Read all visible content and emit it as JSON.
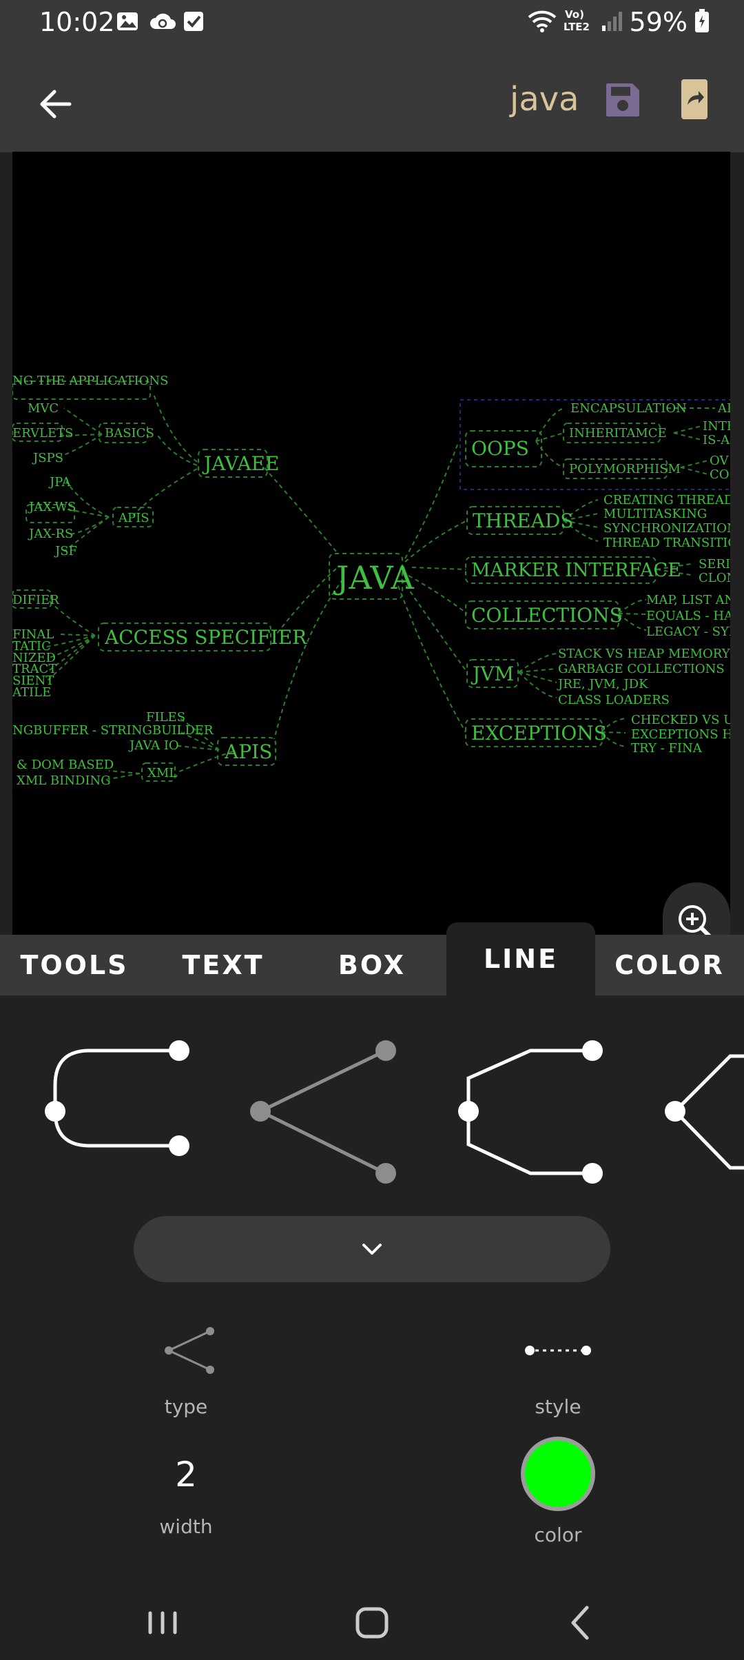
{
  "status": {
    "time": "10:02",
    "battery": "59%",
    "network": "Vo) LTE2"
  },
  "app_bar": {
    "title": "java",
    "back_icon": "arrow-left-icon",
    "save_icon": "floppy-disk-icon",
    "export_icon": "share-document-icon"
  },
  "mindmap": {
    "root": "JAVA",
    "branches": [
      "JAVAEE",
      "ACCESS SPECIFIER",
      "APIS",
      "OOPS",
      "THREADS",
      "MARKER INTERFACE",
      "COLLECTIONS",
      "JVM",
      "EXCEPTIONS"
    ],
    "javaee_children": [
      "NG THE APPLICATIONS",
      "MVC",
      "ERVLETS",
      "BASICS",
      "JSPS",
      "JPA",
      "JAX-WS",
      "APIS",
      "JAX-RS",
      "JSF"
    ],
    "access_children": [
      "DIFIER",
      "FINAL",
      "TATIC",
      "NIZED",
      "TRACT",
      "SIENT",
      "ATILE"
    ],
    "apis_children": [
      "FILES",
      "NGBUFFER - STRINGBUILDER",
      "JAVA IO",
      "XML",
      "& DOM BASED",
      "XML BINDING"
    ],
    "oops_children": [
      "ENCAPSULATION",
      "INHERITAMCE",
      "POLYMORPHISM",
      "AB",
      "INTE",
      "IS-A",
      "OV",
      "CO"
    ],
    "threads_children": [
      "CREATING THREADS",
      "MULTITASKING",
      "SYNCHRONIZATION",
      "THREAD TRANSITION"
    ],
    "marker_children": [
      "SERIA",
      "CLON"
    ],
    "collections_children": [
      "MAP, LIST AND",
      "EQUALS - HAS",
      "LEGACY - SYN"
    ],
    "jvm_children": [
      "STACK VS HEAP MEMORY",
      "GARBAGE COLLECTIONS",
      "JRE, JVM, JDK",
      "CLASS LOADERS"
    ],
    "exceptions_children": [
      "CHECKED VS UN",
      "EXCEPTIONS HAN",
      "TRY - FINA"
    ]
  },
  "zoom": {
    "in_icon": "zoom-in-icon",
    "out_icon": "zoom-out-icon"
  },
  "tabs": {
    "tools": "TOOLS",
    "text": "TEXT",
    "box": "BOX",
    "line": "LINE",
    "color": "COLOR",
    "active": "LINE"
  },
  "line_panel": {
    "shapes": [
      "curved-bracket-line-icon",
      "straight-fork-line-icon",
      "angled-bracket-line-icon",
      "angled-fork-line-icon"
    ],
    "selected_shape": "straight-fork-line-icon",
    "collapse_icon": "chevron-down-icon",
    "type_label": "type",
    "style_label": "style",
    "width_value": "2",
    "width_label": "width",
    "color_label": "color",
    "line_color": "#00ff00"
  },
  "colors": {
    "node_text": "#3fbf3f",
    "canvas_bg": "#000000",
    "accent": "#d9c49a"
  }
}
